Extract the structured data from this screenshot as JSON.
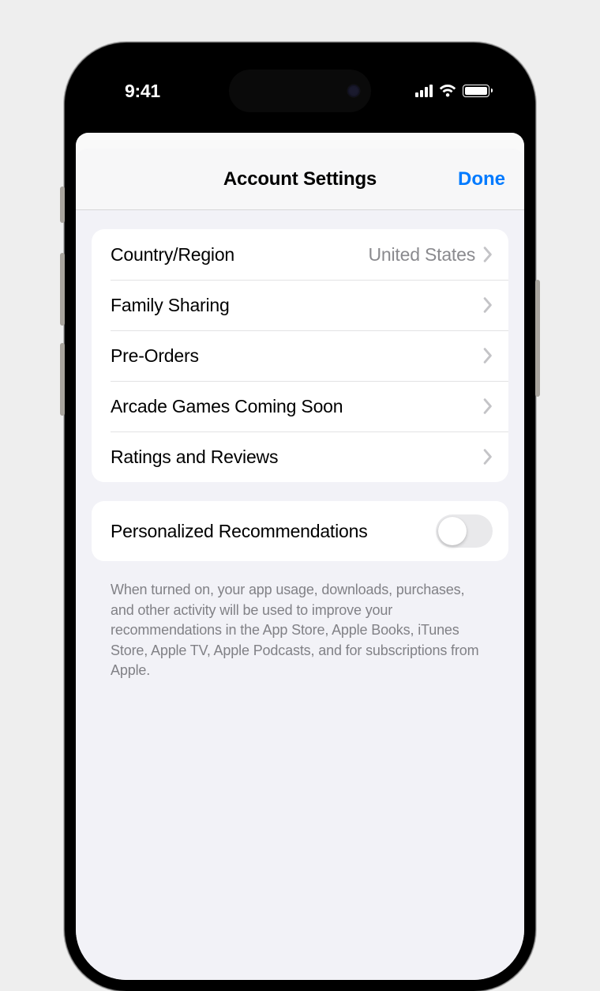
{
  "status": {
    "time": "9:41"
  },
  "nav": {
    "title": "Account Settings",
    "done": "Done"
  },
  "rows": {
    "country": {
      "label": "Country/Region",
      "value": "United States"
    },
    "family": {
      "label": "Family Sharing"
    },
    "preorders": {
      "label": "Pre-Orders"
    },
    "arcade": {
      "label": "Arcade Games Coming Soon"
    },
    "ratings": {
      "label": "Ratings and Reviews"
    },
    "recs": {
      "label": "Personalized Recommendations"
    }
  },
  "footer": "When turned on, your app usage, downloads, purchases, and other activity will be used to improve your recommendations in the App Store, Apple Books, iTunes Store, Apple TV, Apple Podcasts, and for subscriptions from Apple."
}
